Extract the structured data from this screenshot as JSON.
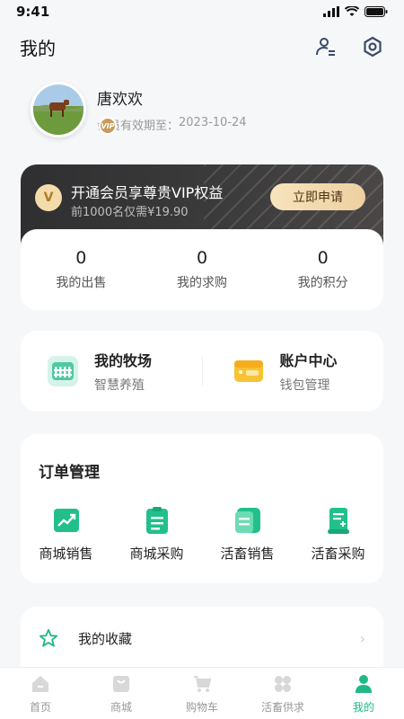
{
  "status_bar": {
    "time": "9:41"
  },
  "header": {
    "title": "我的"
  },
  "profile": {
    "username": "唐欢欢",
    "vip_badge": "VIP",
    "expiry_label": "会员有效期至：",
    "expiry_date": "2023-10-24"
  },
  "vip": {
    "logo": "V",
    "title": "开通会员享尊贵VIP权益",
    "subtitle": "前1000名仅需¥19.90",
    "button": "立即申请"
  },
  "stats": [
    {
      "value": "0",
      "label": "我的出售"
    },
    {
      "value": "0",
      "label": "我的求购"
    },
    {
      "value": "0",
      "label": "我的积分"
    }
  ],
  "ranch": [
    {
      "title": "我的牧场",
      "subtitle": "智慧养殖",
      "icon": "fence-icon"
    },
    {
      "title": "账户中心",
      "subtitle": "钱包管理",
      "icon": "wallet-icon"
    }
  ],
  "orders": {
    "title": "订单管理",
    "items": [
      {
        "label": "商城销售",
        "icon": "chart-up-icon"
      },
      {
        "label": "商城采购",
        "icon": "clipboard-icon"
      },
      {
        "label": "活畜销售",
        "icon": "livestock-list-icon"
      },
      {
        "label": "活畜采购",
        "icon": "scroll-add-icon"
      }
    ]
  },
  "favorites": {
    "label": "我的收藏",
    "icon": "star-icon"
  },
  "tabs": [
    {
      "label": "首页",
      "icon": "home-icon",
      "active": false
    },
    {
      "label": "商城",
      "icon": "shop-icon",
      "active": false
    },
    {
      "label": "购物车",
      "icon": "cart-icon",
      "active": false
    },
    {
      "label": "活畜供求",
      "icon": "clover-icon",
      "active": false
    },
    {
      "label": "我的",
      "icon": "person-icon",
      "active": true
    }
  ],
  "colors": {
    "accent": "#1fb985",
    "vip_gold": "#f3dca9",
    "dark_card": "#2f2f31"
  }
}
